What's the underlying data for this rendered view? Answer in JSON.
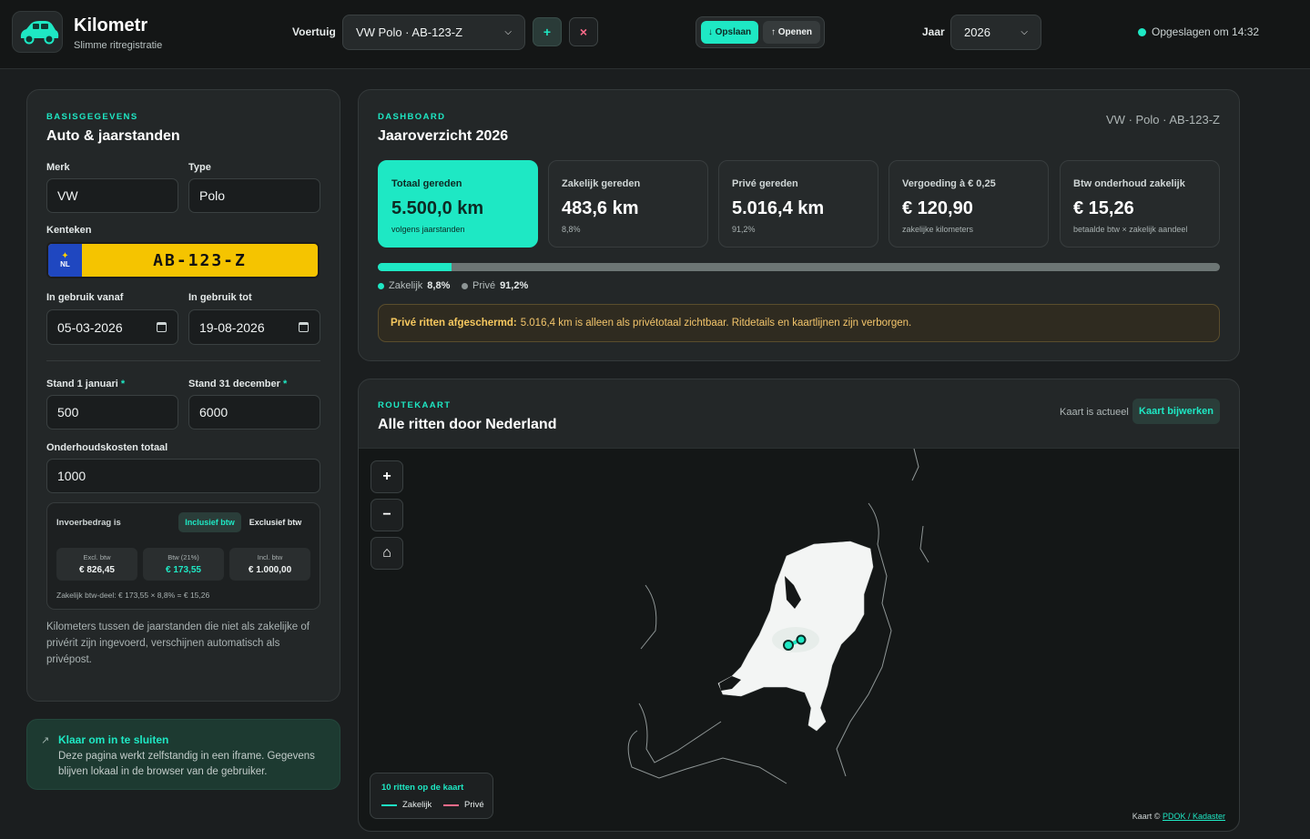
{
  "app": {
    "name": "Kilometr",
    "tagline": "Slimme ritregistratie"
  },
  "header": {
    "vehicle_label": "Voertuig",
    "vehicle_selected": "VW Polo · AB-123-Z",
    "add_label": "+",
    "remove_label": "×",
    "save_label": "↓ Opslaan",
    "open_label": "↑ Openen",
    "year_label": "Jaar",
    "year_selected": "2026",
    "status": "Opgeslagen om 14:32"
  },
  "basics": {
    "eyebrow": "BASISGEGEVENS",
    "title": "Auto & jaarstanden",
    "brand_label": "Merk",
    "brand_value": "VW",
    "type_label": "Type",
    "type_value": "Polo",
    "plate_label": "Kenteken",
    "plate_country": "NL",
    "plate_value": "AB-123-Z",
    "from_label": "In gebruik vanaf",
    "from_value": "05-03-2026",
    "to_label": "In gebruik tot",
    "to_value": "19-08-2026",
    "start_label": "Stand 1 januari",
    "start_value": "500",
    "end_label": "Stand 31 december",
    "end_value": "6000",
    "required_mark": "*",
    "maint_label": "Onderhoudskosten totaal",
    "maint_value": "1000",
    "vat": {
      "mode_label": "Invoerbedrag is",
      "incl_label": "Inclusief btw",
      "excl_label": "Exclusief btw",
      "cells": [
        {
          "label": "Excl. btw",
          "value": "€ 826,45"
        },
        {
          "label": "Btw (21%)",
          "value": "€ 173,55"
        },
        {
          "label": "Incl. btw",
          "value": "€ 1.000,00"
        }
      ],
      "formula": "Zakelijk btw-deel: € 173,55 × 8,8% = € 15,26"
    },
    "note": "Kilometers tussen de jaarstanden die niet als zakelijke of privérit zijn ingevoerd, verschijnen automatisch als privépost."
  },
  "ready": {
    "icon": "↗",
    "title": "Klaar om in te sluiten",
    "text": "Deze pagina werkt zelfstandig in een iframe. Gegevens blijven lokaal in de browser van de gebruiker."
  },
  "dashboard": {
    "eyebrow": "DASHBOARD",
    "title": "Jaaroverzicht 2026",
    "vehicle": "VW · Polo · AB-123-Z",
    "stats": [
      {
        "title": "Totaal gereden",
        "value": "5.500,0 km",
        "sub": "volgens jaarstanden"
      },
      {
        "title": "Zakelijk gereden",
        "value": "483,6 km",
        "sub": "8,8%"
      },
      {
        "title": "Privé gereden",
        "value": "5.016,4 km",
        "sub": "91,2%"
      },
      {
        "title": "Vergoeding à € 0,25",
        "value": "€ 120,90",
        "sub": "zakelijke kilometers"
      },
      {
        "title": "Btw onderhoud zakelijk",
        "value": "€ 15,26",
        "sub": "betaalde btw × zakelijk aandeel"
      }
    ],
    "business_share": 0.088,
    "legend_business_label": "Zakelijk",
    "legend_business_value": "8,8%",
    "legend_private_label": "Privé",
    "legend_private_value": "91,2%",
    "warning_bold": "Privé ritten afgeschermd:",
    "warning_text": "5.016,4 km is alleen als privétotaal zichtbaar. Ritdetails en kaartlijnen zijn verborgen."
  },
  "map": {
    "eyebrow": "ROUTEKAART",
    "title": "Alle ritten door Nederland",
    "status": "Kaart is actueel",
    "refresh_label": "Kaart bijwerken",
    "zoom_in": "+",
    "zoom_out": "−",
    "home": "⌂",
    "legend_title": "10 ritten op de kaart",
    "legend_business": "Zakelijk",
    "legend_private": "Privé",
    "attribution_prefix": "Kaart ©",
    "attribution_link": "PDOK / Kadaster"
  },
  "colors": {
    "accent": "#1ee8c4",
    "private": "#ff6b8a",
    "warning": "#f3c56b",
    "plate": "#f5c400"
  }
}
